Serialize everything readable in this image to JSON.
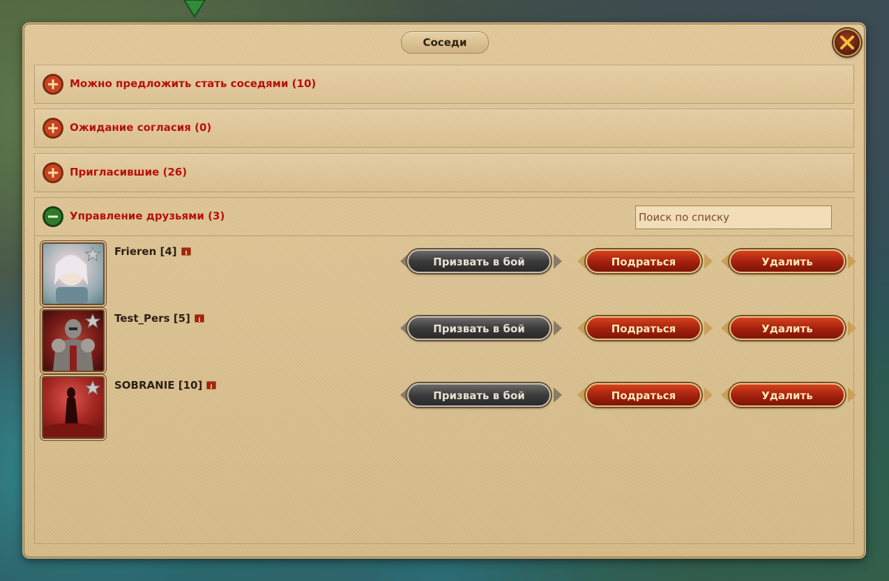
{
  "dialog": {
    "title": "Соседи"
  },
  "sections": [
    {
      "label": "Можно предложить стать соседями (10)",
      "expanded": false
    },
    {
      "label": "Ожидание согласия (0)",
      "expanded": false
    },
    {
      "label": "Пригласившие (26)",
      "expanded": false
    },
    {
      "label": "Управление друзьями (3)",
      "expanded": true
    }
  ],
  "search": {
    "placeholder": "Поиск по списку"
  },
  "friends": [
    {
      "name": "Frieren [4]",
      "avatar": "white-haired-elf-avatar"
    },
    {
      "name": "Test_Pers [5]",
      "avatar": "armored-knight-avatar"
    },
    {
      "name": "SOBRANIE [10]",
      "avatar": "red-silhouette-avatar"
    }
  ],
  "buttons": {
    "summon": "Призвать в бой",
    "fight": "Подраться",
    "delete": "Удалить"
  },
  "colors": {
    "section_label": "#b80f0a",
    "panel_bg": "#dcc393",
    "expand_icon": "#c8441e",
    "collapse_icon": "#2f7a2a"
  }
}
